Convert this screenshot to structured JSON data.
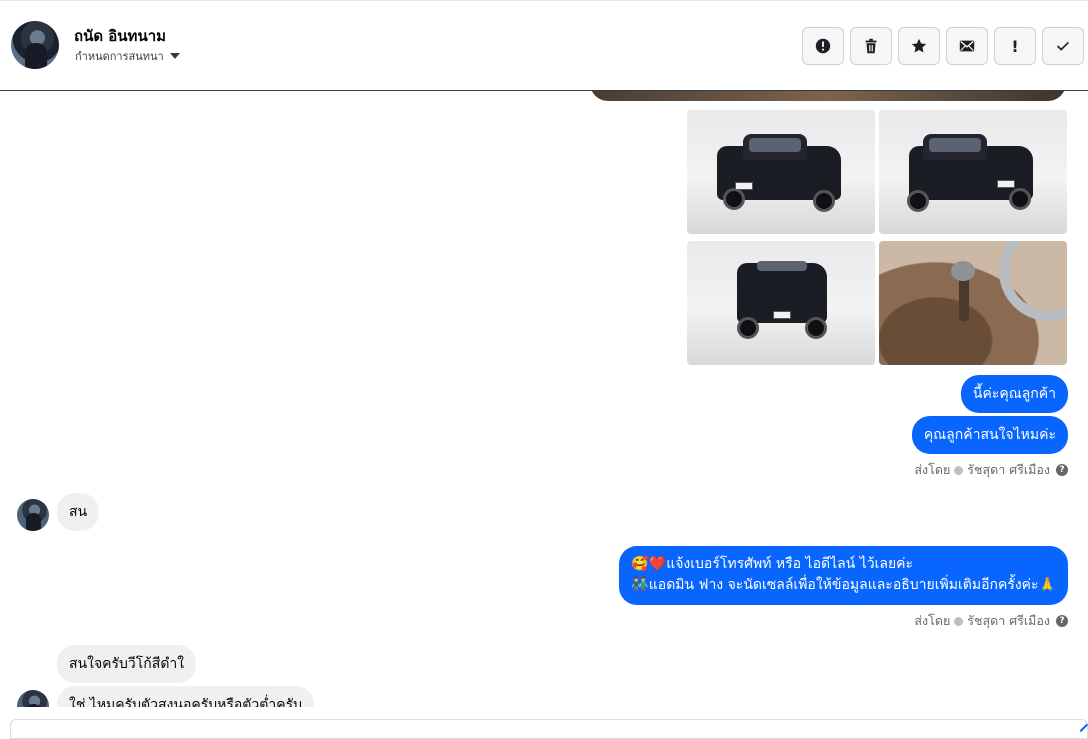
{
  "header": {
    "name": "ถนัด อินทนาม",
    "subtitle": "กำหนดการสนทนา",
    "actions": [
      {
        "name": "alert-circle-icon",
        "label": ""
      },
      {
        "name": "trash-icon",
        "label": ""
      },
      {
        "name": "star-icon",
        "label": ""
      },
      {
        "name": "envelope-icon",
        "label": ""
      },
      {
        "name": "exclamation-icon",
        "label": "!"
      },
      {
        "name": "check-icon",
        "label": ""
      }
    ]
  },
  "thread": {
    "photos": [
      "truck-front-left",
      "truck-front-right",
      "truck-rear",
      "truck-interior"
    ],
    "outgoing_1": "นี้ค่ะคุณลูกค้า",
    "outgoing_2": "คุณลูกค้าสนใจไหมค่ะ",
    "sent_by_label": "ส่งโดย",
    "sender_name": "รัชสุดา ศรีเมือง",
    "incoming_1": "สน",
    "outgoing_3_line1": "🥰❤️แจ้งเบอร์โทรศัพท์ หรือ ไอดีไลน์  ไว้เลยค่ะ",
    "outgoing_3_line2": "👬แอดมิน ฟาง จะนัดเซลล์เพื่อให้ข้อมูลและอธิบายเพิ่มเติมอีกครั้งค่ะ🙏",
    "incoming_2": "สนใจครับวีโก้สีดำใ",
    "incoming_3": "ใช่ ไหมครับตัวสูงนอครับหรือตัวต่ำครับ"
  },
  "colors": {
    "outgoing_bubble": "#0866ff",
    "incoming_bubble": "#f0f0f0"
  }
}
